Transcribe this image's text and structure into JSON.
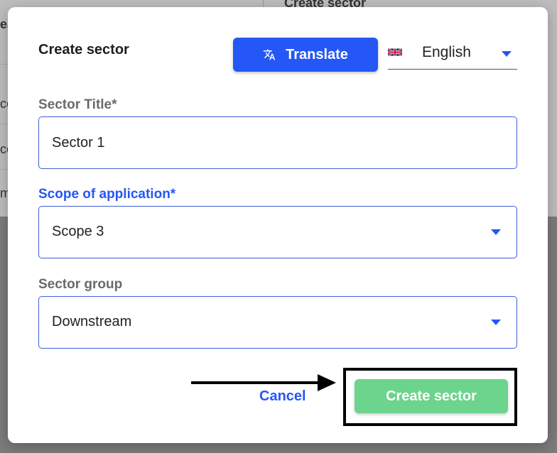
{
  "background": {
    "header_fragment": "Create sector",
    "row_fragments": [
      "ea",
      "co",
      "co",
      "m"
    ]
  },
  "modal": {
    "title": "Create sector",
    "translate_button": {
      "label": "Translate",
      "icon": "translate-icon",
      "color": "#2457f5"
    },
    "language": {
      "selected": "English",
      "flag": "uk-flag-icon"
    },
    "fields": {
      "sector_title": {
        "label": "Sector Title*",
        "value": "Sector 1"
      },
      "scope": {
        "label": "Scope of application*",
        "value": "Scope 3"
      },
      "sector_group": {
        "label": "Sector group",
        "value": "Downstream"
      }
    },
    "actions": {
      "cancel_label": "Cancel",
      "create_label": "Create sector",
      "create_color": "#6cd48d"
    }
  },
  "annotation": {
    "type": "arrow-and-box",
    "target": "create-sector-button",
    "color": "#000000"
  }
}
